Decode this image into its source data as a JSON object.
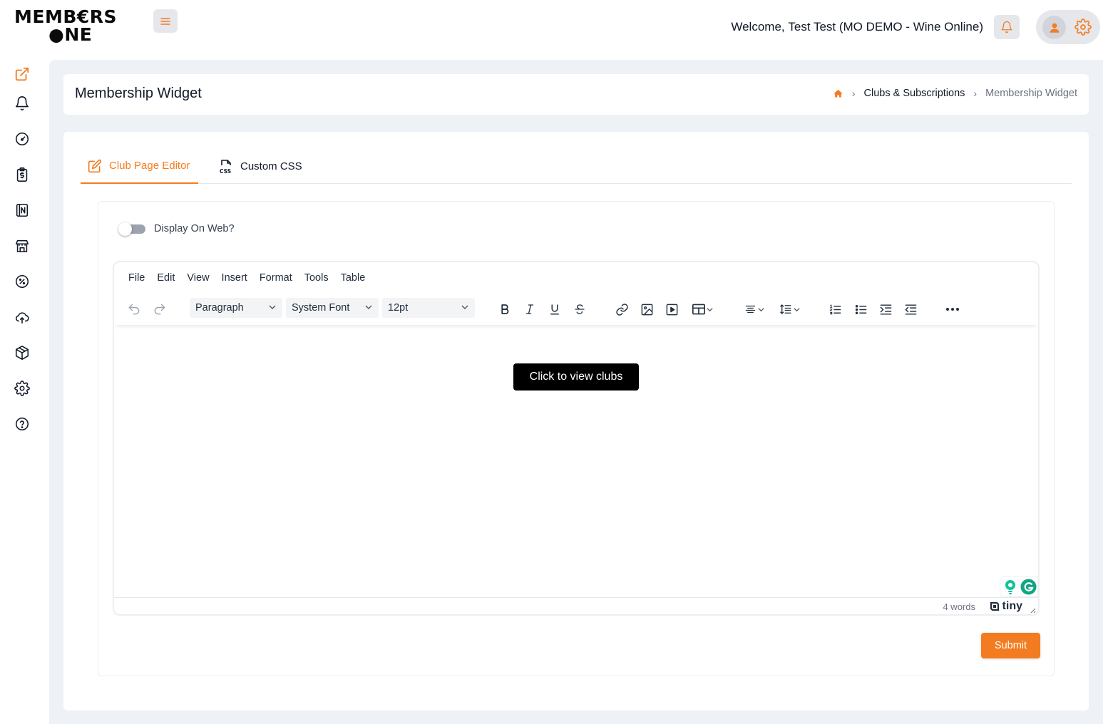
{
  "app": {
    "logo_line1": "MEMB€RS",
    "logo_line2": "●NE"
  },
  "header": {
    "welcome_prefix": "Welcome,",
    "welcome_name": "Test Test (MO DEMO - Wine Online)"
  },
  "sidebar": {
    "items": [
      {
        "icon": "external-link-icon",
        "active": true
      },
      {
        "icon": "bell-icon"
      },
      {
        "icon": "dashboard-gauge-icon"
      },
      {
        "icon": "clipboard-dollar-icon"
      },
      {
        "icon": "notebook-icon"
      },
      {
        "icon": "store-icon"
      },
      {
        "icon": "discount-percent-icon"
      },
      {
        "icon": "cloud-upload-icon"
      },
      {
        "icon": "box-icon"
      },
      {
        "icon": "settings-gear-icon"
      },
      {
        "icon": "help-circle-icon"
      }
    ]
  },
  "page": {
    "title": "Membership Widget",
    "breadcrumb": {
      "home_icon": "home-icon",
      "items": [
        "Clubs & Subscriptions",
        "Membership Widget"
      ]
    }
  },
  "tabs": [
    {
      "label": "Club Page Editor",
      "icon": "edit-icon",
      "active": true
    },
    {
      "label": "Custom CSS",
      "icon": "css-file-icon",
      "active": false
    }
  ],
  "form": {
    "display_on_web_label": "Display On Web?",
    "display_on_web": false,
    "submit_label": "Submit"
  },
  "editor": {
    "menus": [
      "File",
      "Edit",
      "View",
      "Insert",
      "Format",
      "Tools",
      "Table"
    ],
    "block_format": "Paragraph",
    "font_family": "System Font",
    "font_size": "12pt",
    "content_button": "Click to view clubs",
    "word_count": "4 words",
    "brand": "tiny"
  },
  "colors": {
    "accent": "#f47c20",
    "background": "#eef1f5",
    "button_dark": "#000000"
  }
}
